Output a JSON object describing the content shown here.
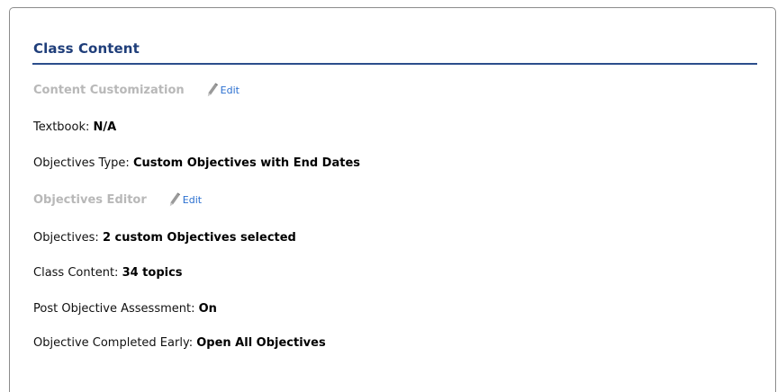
{
  "panel": {
    "title": "Class Content"
  },
  "content_customization": {
    "heading": "Content Customization",
    "edit_label": "Edit",
    "edit_icon": "pencil-icon"
  },
  "textbook": {
    "label": "Textbook:",
    "value": "N/A"
  },
  "objectives_type": {
    "label": "Objectives Type:",
    "value": "Custom Objectives with End Dates"
  },
  "objectives_editor": {
    "heading": "Objectives Editor",
    "edit_label": "Edit",
    "edit_icon": "pencil-icon"
  },
  "objectives": {
    "label": "Objectives:",
    "value": "2 custom Objectives selected"
  },
  "class_content": {
    "label": "Class Content:",
    "value": "34 topics"
  },
  "post_objective_assessment": {
    "label": "Post Objective Assessment:",
    "value": "On"
  },
  "objective_completed_early": {
    "label": "Objective Completed Early:",
    "value": "Open All Objectives"
  },
  "colors": {
    "title": "#1f3e7a",
    "rule": "#2b4e8c",
    "section_heading": "#b8b8b8",
    "edit_link": "#2a6fd0"
  }
}
